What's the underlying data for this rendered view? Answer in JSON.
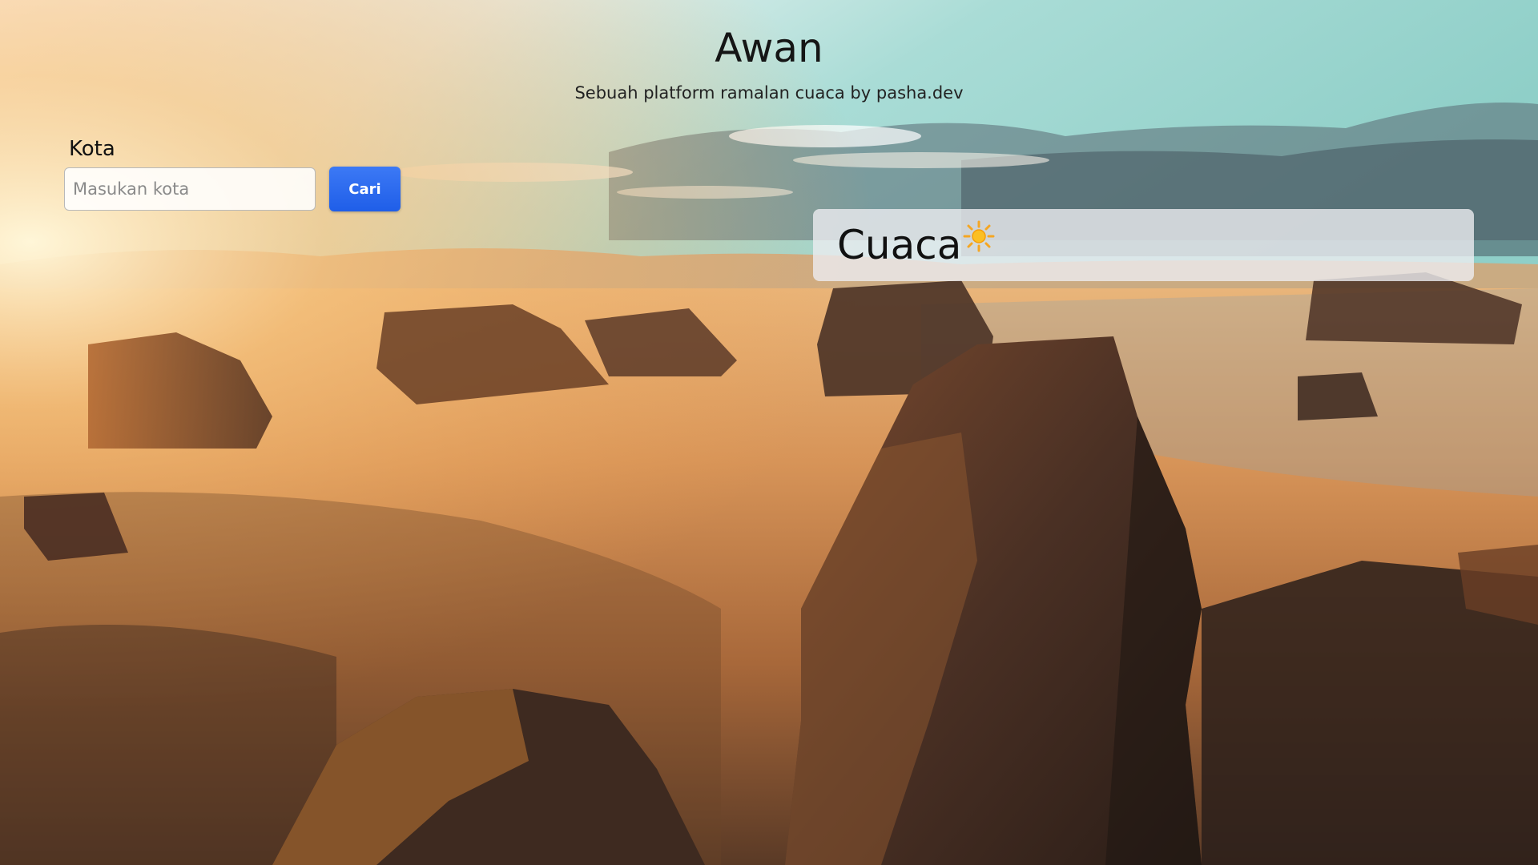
{
  "header": {
    "title": "Awan",
    "subtitle": "Sebuah platform ramalan cuaca by pasha.dev"
  },
  "search": {
    "label": "Kota",
    "placeholder": "Masukan kota",
    "value": "",
    "button_label": "Cari"
  },
  "weather": {
    "title": "Cuaca",
    "icon": "sun-icon"
  },
  "colors": {
    "accent": "#2563eb",
    "card_bg": "#ececf0"
  },
  "background": {
    "icon": "desert-landscape"
  }
}
